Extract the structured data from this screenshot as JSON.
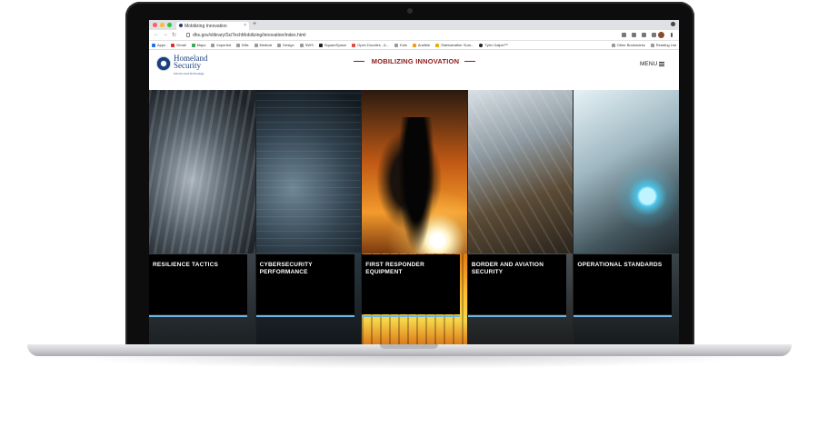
{
  "browser": {
    "tab_title": "Mobilizing Innovation",
    "url": "dhs.gov/xlibrary/SciTechMobilizing/innovation/index.html",
    "bookmarks": [
      "Apps",
      "Gmail",
      "Maps",
      "Imported",
      "Bills",
      "Medical",
      "Design",
      "SWS",
      "SquareSpace",
      "Open Doodles - A...",
      "Kids",
      "Audible",
      "Starkweather Sum...",
      "Tyler Galpin™"
    ],
    "other_bookmarks": "Other Bookmarks",
    "reading_list": "Reading List"
  },
  "site": {
    "brand_line1": "Homeland",
    "brand_line2": "Security",
    "brand_sub": "Science and Technology",
    "title": "MOBILIZING INNOVATION",
    "menu_label": "MENU",
    "panels": [
      {
        "label": "RESILIENCE TACTICS"
      },
      {
        "label": "CYBERSECURITY PERFORMANCE"
      },
      {
        "label": "FIRST RESPONDER EQUIPMENT"
      },
      {
        "label": "BORDER AND AVIATION SECURITY"
      },
      {
        "label": "OPERATIONAL STANDARDS"
      }
    ]
  },
  "colors": {
    "title_red": "#8b1a1a",
    "brand_blue": "#1c3f7c",
    "card_rule": "#6fb6e6"
  }
}
